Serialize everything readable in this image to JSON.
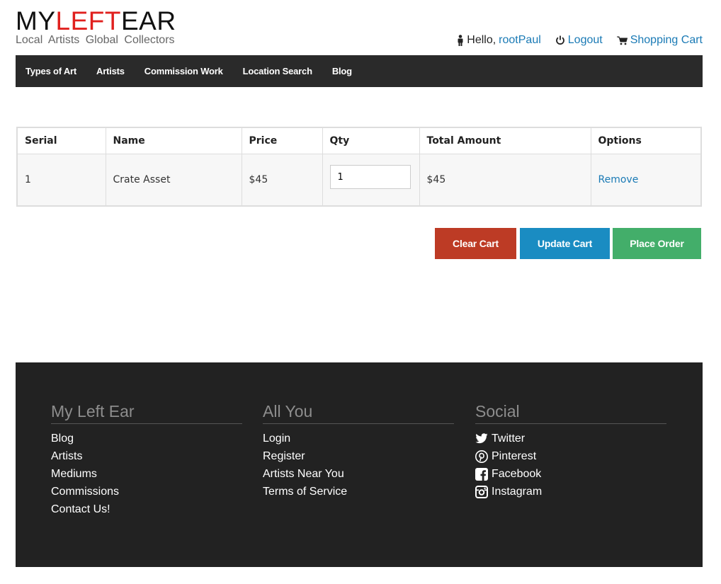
{
  "header": {
    "logo": {
      "part1": "MY",
      "part2": "LEFT",
      "part3": "EAR"
    },
    "tagline": "Local Artists  Global Collectors",
    "greeting": "Hello,",
    "username": "rootPaul",
    "logout": "Logout",
    "cart": "Shopping Cart"
  },
  "nav": [
    "Types of Art",
    "Artists",
    "Commission Work",
    "Location Search",
    "Blog"
  ],
  "table": {
    "headers": [
      "Serial",
      "Name",
      "Price",
      "Qty",
      "Total Amount",
      "Options"
    ],
    "rows": [
      {
        "serial": "1",
        "name": "Crate Asset",
        "price": "$45",
        "qty": "1",
        "total": "$45",
        "option": "Remove"
      }
    ]
  },
  "buttons": {
    "clear": "Clear Cart",
    "update": "Update Cart",
    "place": "Place Order"
  },
  "footer": {
    "col1": {
      "title": "My Left Ear",
      "items": [
        "Blog",
        "Artists",
        "Mediums",
        "Commissions",
        "Contact Us!"
      ]
    },
    "col2": {
      "title": "All You",
      "items": [
        "Login",
        "Register",
        "Artists Near You",
        "Terms of Service"
      ]
    },
    "col3": {
      "title": "Social",
      "items": [
        {
          "label": "Twitter",
          "icon": "twitter-icon"
        },
        {
          "label": "Pinterest",
          "icon": "pinterest-icon"
        },
        {
          "label": "Facebook",
          "icon": "facebook-icon"
        },
        {
          "label": "Instagram",
          "icon": "instagram-icon"
        }
      ]
    }
  },
  "colors": {
    "brand_red": "#e0201e",
    "link": "#1a7ab5",
    "clear": "#bd3b25",
    "update": "#1a8cc2",
    "place": "#43ae6a",
    "nav_bg": "#2a2a2a",
    "footer_bg": "#222222"
  }
}
